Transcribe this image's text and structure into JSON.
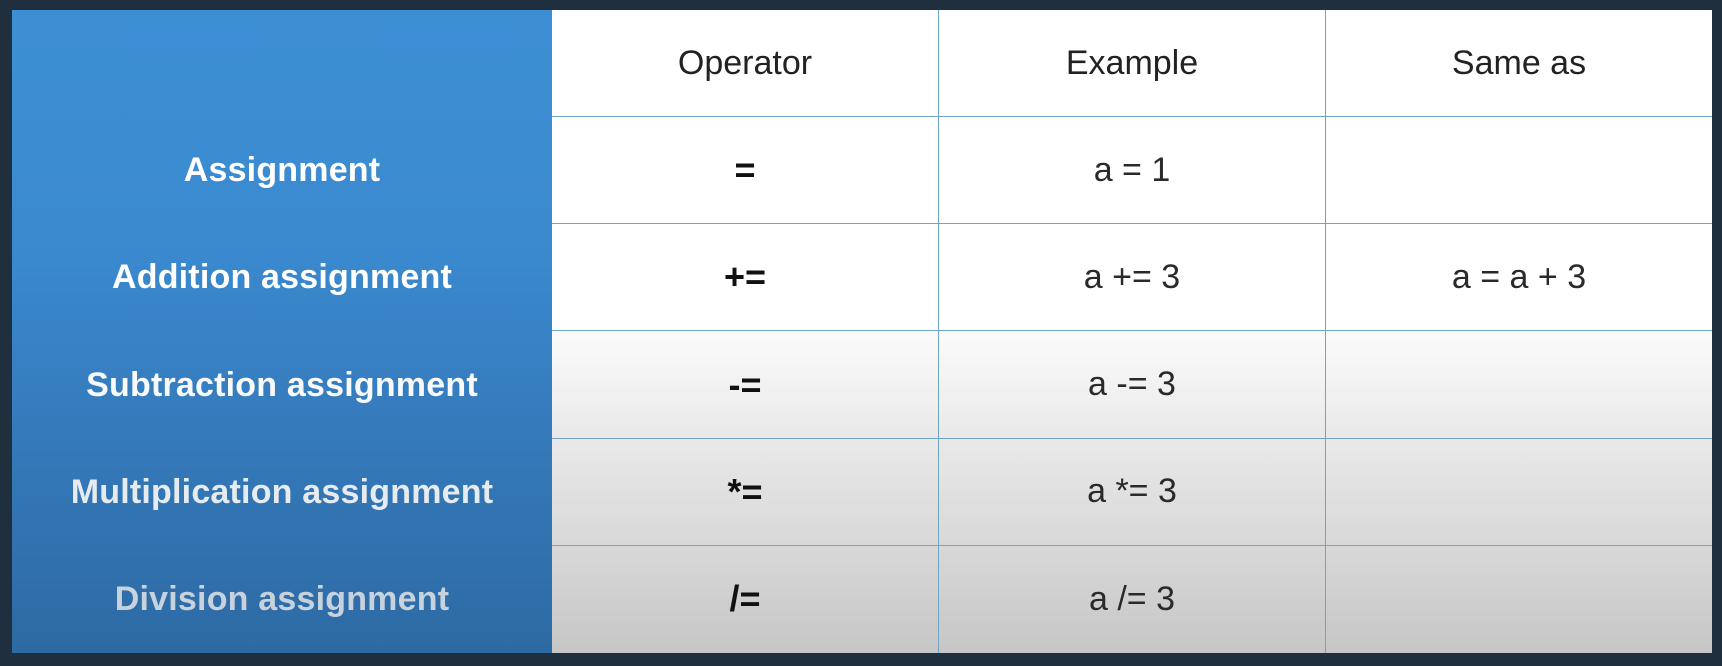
{
  "header": {
    "operator": "Operator",
    "example": "Example",
    "same_as": "Same as"
  },
  "rows": [
    {
      "label": "Assignment",
      "operator": "=",
      "example": "a = 1",
      "same_as": ""
    },
    {
      "label": "Addition assignment",
      "operator": "+=",
      "example": "a += 3",
      "same_as": "a = a + 3"
    },
    {
      "label": "Subtraction assignment",
      "operator": "-=",
      "example": "a -= 3",
      "same_as": ""
    },
    {
      "label": "Multiplication assignment",
      "operator": "*=",
      "example": "a *= 3",
      "same_as": ""
    },
    {
      "label": "Division assignment",
      "operator": "/=",
      "example": "a /= 3",
      "same_as": ""
    }
  ]
}
